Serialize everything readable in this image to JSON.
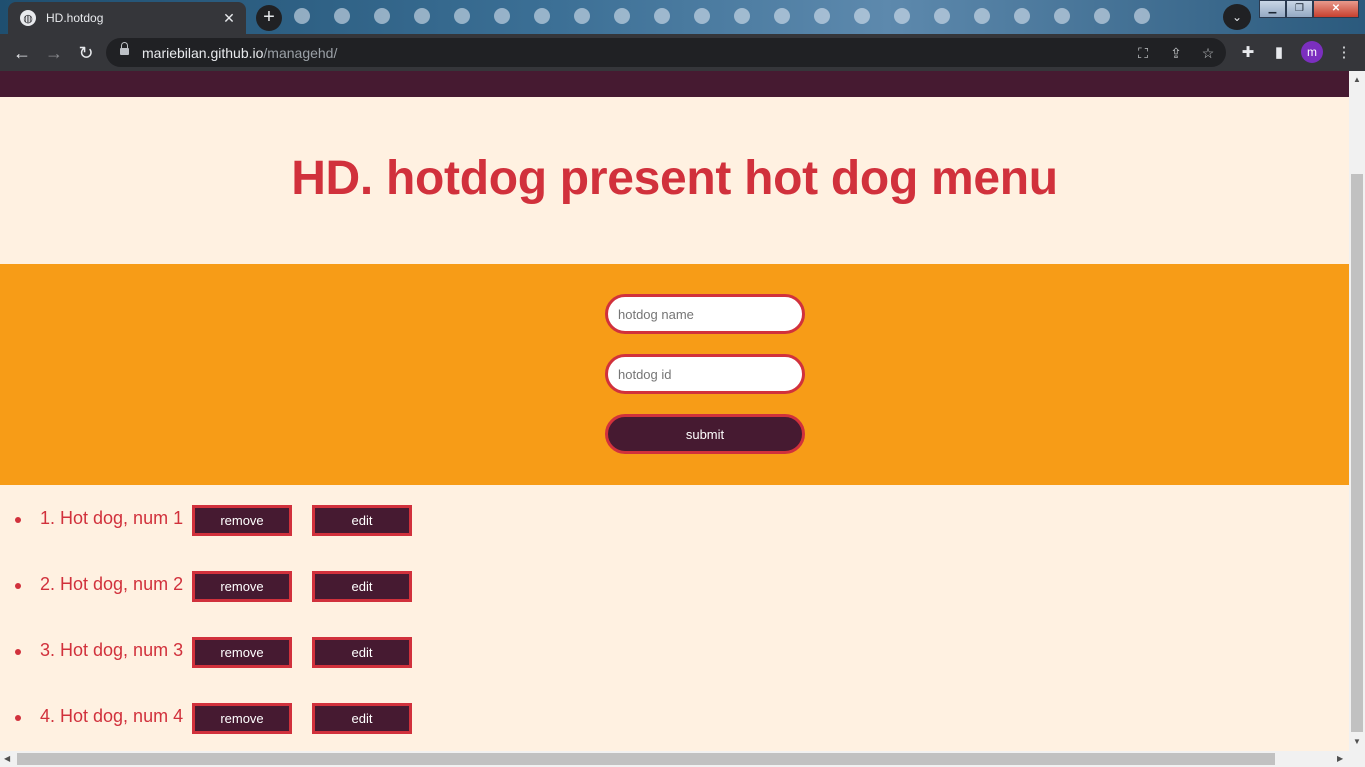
{
  "browser": {
    "tab_title": "HD.hotdog",
    "tab_close": "✕",
    "new_tab": "+",
    "url_host": "mariebilan.github.io",
    "url_path": "/managehd/",
    "profile_initial": "m"
  },
  "page": {
    "heading": "HD. hotdog present hot dog menu",
    "form": {
      "name_placeholder": "hotdog name",
      "id_placeholder": "hotdog id",
      "submit_label": "submit"
    },
    "items": [
      {
        "label": "1. Hot dog, num 1",
        "remove_label": "remove",
        "edit_label": "edit"
      },
      {
        "label": "2. Hot dog, num 2",
        "remove_label": "remove",
        "edit_label": "edit"
      },
      {
        "label": "3. Hot dog, num 3",
        "remove_label": "remove",
        "edit_label": "edit"
      },
      {
        "label": "4. Hot dog, num 4",
        "remove_label": "remove",
        "edit_label": "edit"
      }
    ]
  },
  "colors": {
    "accent_red": "#d1313c",
    "dark_plum": "#461a31",
    "orange_band": "#f79c17",
    "page_bg": "#fff1e1"
  }
}
